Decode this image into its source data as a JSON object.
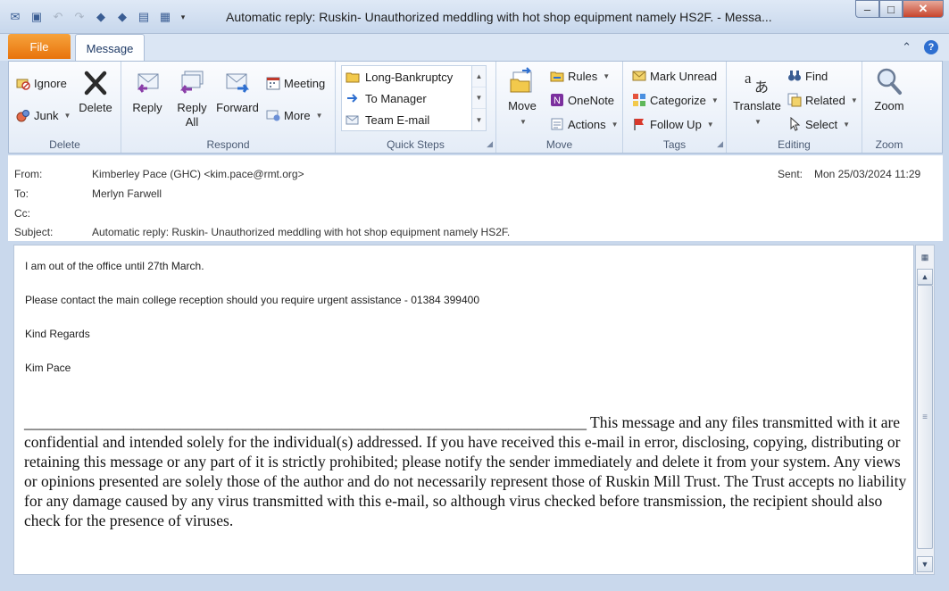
{
  "window": {
    "title": "Automatic reply: Ruskin- Unauthorized meddling with hot shop equipment namely HS2F.  -  Messa...",
    "minimize": "–",
    "maximize": "□",
    "close": "✕"
  },
  "tabs": {
    "file": "File",
    "message": "Message"
  },
  "ribbon": {
    "delete_group": {
      "label": "Delete",
      "ignore": "Ignore",
      "junk": "Junk",
      "delete": "Delete"
    },
    "respond_group": {
      "label": "Respond",
      "reply": "Reply",
      "reply_all_1": "Reply",
      "reply_all_2": "All",
      "forward": "Forward",
      "meeting": "Meeting",
      "more": "More"
    },
    "quicksteps_group": {
      "label": "Quick Steps",
      "items": [
        "Long-Bankruptcy",
        "To Manager",
        "Team E-mail"
      ]
    },
    "move_group": {
      "label": "Move",
      "move": "Move",
      "rules": "Rules",
      "onenote": "OneNote",
      "actions": "Actions"
    },
    "tags_group": {
      "label": "Tags",
      "mark_unread": "Mark Unread",
      "categorize": "Categorize",
      "follow_up": "Follow Up"
    },
    "editing_group": {
      "label": "Editing",
      "translate": "Translate",
      "find": "Find",
      "related": "Related",
      "select": "Select"
    },
    "zoom_group": {
      "label": "Zoom",
      "zoom": "Zoom"
    }
  },
  "header": {
    "from_label": "From:",
    "from_value": "Kimberley Pace (GHC) <kim.pace@rmt.org>",
    "to_label": "To:",
    "to_value": "Merlyn Farwell",
    "cc_label": "Cc:",
    "cc_value": "",
    "subject_label": "Subject:",
    "subject_value": "Automatic reply: Ruskin- Unauthorized meddling with hot shop equipment namely HS2F.",
    "sent_label": "Sent:",
    "sent_value": "Mon 25/03/2024 11:29"
  },
  "message": {
    "line1": "I am out of the office until 27th March.",
    "line2": "Please contact the main college reception should you require urgent assistance - 01384 399400",
    "line3": "Kind Regards",
    "line4": "Kim Pace",
    "disclaimer": "________________________________________________________________________ This message and any files transmitted with it are confidential and intended solely for the individual(s) addressed. If you have received this e-mail in error, disclosing, copying, distributing or retaining this message or any part of it is strictly prohibited; please notify the sender immediately and delete it from your system. Any views or opinions presented are solely those of the author and do not necessarily represent those of Ruskin Mill Trust. The Trust accepts no liability for any damage caused by any virus transmitted with this e-mail, so although virus checked before transmission, the recipient should also check for the presence of viruses."
  }
}
